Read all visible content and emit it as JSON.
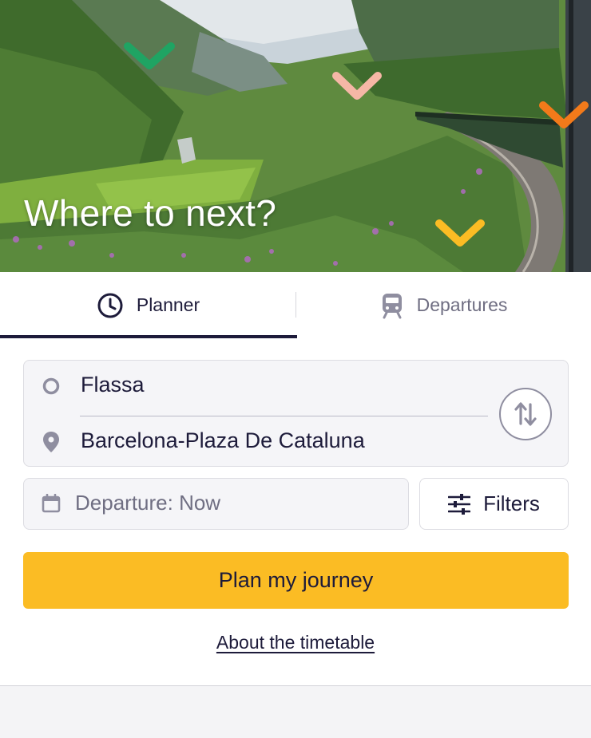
{
  "hero": {
    "title": "Where to next?",
    "image": "mountain-valley-train-photo"
  },
  "tabs": [
    {
      "label": "Planner",
      "icon": "clock-icon",
      "active": true
    },
    {
      "label": "Departures",
      "icon": "train-icon",
      "active": false
    }
  ],
  "route": {
    "from": "Flassa",
    "to": "Barcelona-Plaza De Cataluna",
    "swap_icon": "swap-vertical-icon"
  },
  "departure": {
    "label": "Departure: Now",
    "icon": "calendar-icon"
  },
  "filters": {
    "label": "Filters",
    "icon": "sliders-icon"
  },
  "plan_button": {
    "label": "Plan my journey"
  },
  "about_link": {
    "label": "About the timetable"
  },
  "colors": {
    "primary_text": "#1d1b3a",
    "accent_yellow": "#fbbc24",
    "muted_text": "#6f6e82",
    "field_bg": "#f5f5f8"
  }
}
